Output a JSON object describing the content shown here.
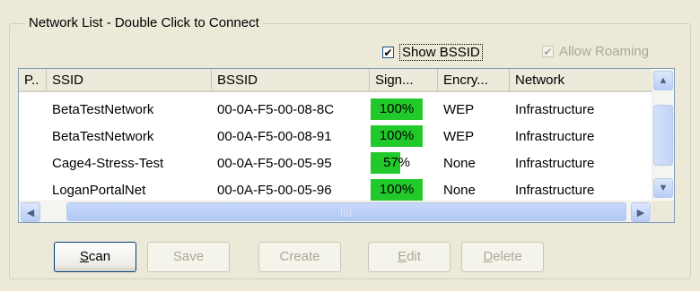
{
  "group_title": "Network List - Double Click to Connect",
  "show_bssid": {
    "label": "Show BSSID",
    "checked": true
  },
  "allow_roaming": {
    "label": "Allow Roaming",
    "checked": true,
    "disabled": true
  },
  "columns": [
    "P..",
    "SSID",
    "BSSID",
    "Sign...",
    "Encry...",
    "Network"
  ],
  "rows": [
    {
      "ssid": "BetaTestNetwork",
      "bssid": "00-0A-F5-00-08-8C",
      "signal": "100%",
      "signal_value": 100,
      "encryption": "WEP",
      "network": "Infrastructure"
    },
    {
      "ssid": "BetaTestNetwork",
      "bssid": "00-0A-F5-00-08-91",
      "signal": "100%",
      "signal_value": 100,
      "encryption": "WEP",
      "network": "Infrastructure"
    },
    {
      "ssid": "Cage4-Stress-Test",
      "bssid": "00-0A-F5-00-05-95",
      "signal": "57%",
      "signal_value": 57,
      "encryption": "None",
      "network": "Infrastructure"
    },
    {
      "ssid": "LoganPortalNet",
      "bssid": "00-0A-F5-00-05-96",
      "signal": "100%",
      "signal_value": 100,
      "encryption": "None",
      "network": "Infrastructure"
    }
  ],
  "buttons": {
    "scan": {
      "label_underlined": "S",
      "label_rest": "can",
      "disabled": false
    },
    "save": {
      "label": "Save",
      "disabled": true
    },
    "create": {
      "label": "Create",
      "disabled": true
    },
    "edit": {
      "label_underlined": "E",
      "label_rest": "dit",
      "disabled": true
    },
    "delete": {
      "label_underlined": "D",
      "label_rest": "elete",
      "disabled": true
    }
  },
  "colors": {
    "signal_fill": "#22c92a",
    "background": "#ece9d8",
    "scroll_blue": "#b8cdf5"
  },
  "icons": {
    "checkmark": "check-icon",
    "scroll_up": "arrow-up-icon",
    "scroll_down": "arrow-down-icon",
    "scroll_left": "arrow-left-icon",
    "scroll_right": "arrow-right-icon"
  }
}
